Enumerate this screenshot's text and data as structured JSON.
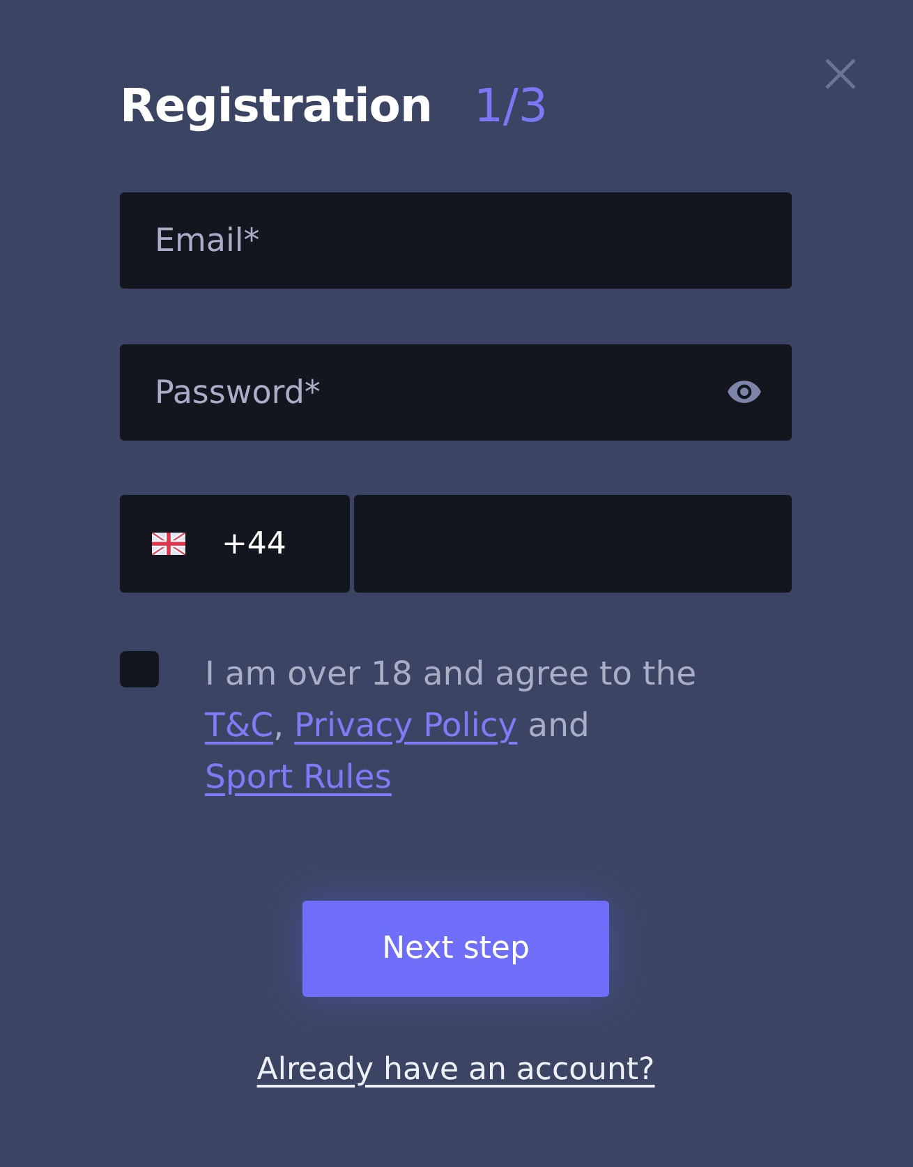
{
  "dialog": {
    "title": "Registration",
    "step": "1/3"
  },
  "fields": [
    {
      "kind": "email",
      "placeholder": "Email*"
    },
    {
      "kind": "password",
      "placeholder": "Password*"
    }
  ],
  "phone": {
    "country_code": "+44"
  },
  "agreement": {
    "checked": false,
    "parts": [
      {
        "kind": "text",
        "text": "I am over 18 and agree to the "
      },
      {
        "kind": "link",
        "text": "T&C"
      },
      {
        "kind": "text",
        "text": ", "
      },
      {
        "kind": "link",
        "text": "Privacy Policy"
      },
      {
        "kind": "text",
        "text": " and "
      },
      {
        "kind": "link",
        "text": "Sport Rules"
      }
    ]
  },
  "primary_button": "Next step",
  "login_link": "Already have an account?"
}
